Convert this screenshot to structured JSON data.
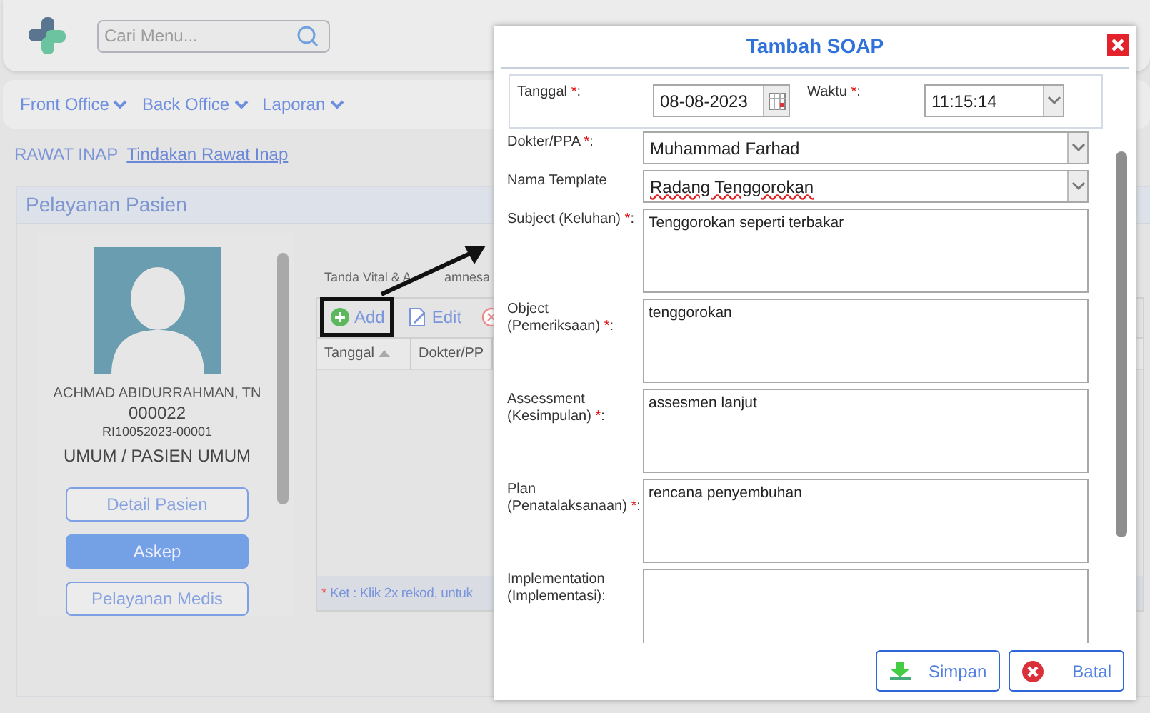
{
  "header": {
    "search": {
      "placeholder": "Cari Menu..."
    }
  },
  "menu": [
    {
      "label": "Front Office"
    },
    {
      "label": "Back Office"
    },
    {
      "label": "Laporan"
    }
  ],
  "breadcrumb": [
    {
      "label": "RAWAT INAP",
      "selected": false
    },
    {
      "label": "Tindakan Rawat Inap",
      "selected": true
    }
  ],
  "panel": {
    "title": "Pelayanan Pasien",
    "patient": {
      "name": "ACHMAD ABIDURRAHMAN, TN",
      "number": "000022",
      "registration": "RI10052023-00001",
      "category": "UMUM / PASIEN UMUM"
    },
    "buttons": [
      {
        "label": "Detail Pasien",
        "selected": false
      },
      {
        "label": "Askep",
        "selected": true
      },
      {
        "label": "Pelayanan Medis",
        "selected": false
      }
    ],
    "tab_title": [
      "Tanda Vital & A",
      "amnesa"
    ],
    "toolbar": [
      {
        "kind": "add",
        "label": "Add",
        "highlighted": true
      },
      {
        "kind": "edit",
        "label": "Edit",
        "highlighted": false
      },
      {
        "kind": "delete",
        "highlighted": false
      }
    ],
    "columns": [
      {
        "label": "Tanggal",
        "sorted": true
      },
      {
        "label": "Dokter/PP",
        "sorted": false
      }
    ],
    "note": {
      "mark": "*",
      "text": "Ket : Klik 2x rekod, untuk"
    }
  },
  "dialog": {
    "title": "Tambah SOAP",
    "header_fields": [
      {
        "label": "Tanggal ",
        "required_mark": "*",
        "label_end": ":",
        "kind": "date",
        "value": "08-08-2023"
      },
      {
        "label": "Waktu ",
        "required_mark": "*",
        "label_end": ":",
        "kind": "select",
        "value": "11:15:14"
      }
    ],
    "fields": [
      {
        "label": "Dokter/PPA ",
        "required_mark": "*",
        "label_end": ":",
        "kind": "select",
        "value": "Muhammad Farhad"
      },
      {
        "label": "Nama Template",
        "kind": "select",
        "value": "Radang Tenggorokan",
        "spelling_error": true
      },
      {
        "label": "Subject (Keluhan) ",
        "required_mark": "*",
        "label_end": ":",
        "kind": "textarea",
        "value": "Tenggorokan seperti terbakar"
      },
      {
        "label": "Object (Pemeriksaan) ",
        "required_mark": "*",
        "label_end": ":",
        "kind": "textarea",
        "value": "tenggorokan"
      },
      {
        "label": "Assessment (Kesimpulan) ",
        "required_mark": "*",
        "label_end": ":",
        "kind": "textarea",
        "value": "assesmen lanjut"
      },
      {
        "label": "Plan (Penatalaksanaan) ",
        "required_mark": "*",
        "label_end": ":",
        "kind": "textarea",
        "value": "rencana penyembuhan"
      },
      {
        "label": "Implementation (Implementasi):",
        "kind": "textarea"
      }
    ],
    "buttons": [
      {
        "kind": "save",
        "label": "Simpan"
      },
      {
        "kind": "cancel",
        "label": "Batal"
      }
    ]
  }
}
